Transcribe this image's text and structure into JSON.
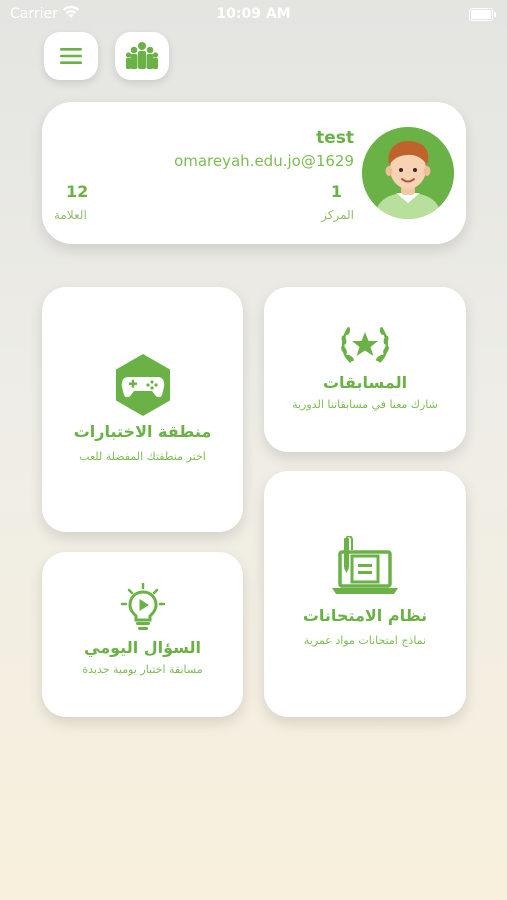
{
  "status_bar": {
    "carrier": "Carrier",
    "time": "10:09 AM"
  },
  "header": {
    "menu_icon": "hamburger-menu-icon",
    "group_icon": "people-group-icon"
  },
  "profile": {
    "name": "test",
    "email": "omareyah.edu.jo@1629",
    "rank_value": "1",
    "rank_label": "المركز",
    "score_value": "12",
    "score_label": "العلامة"
  },
  "tiles": {
    "competitions": {
      "title": "المسابقات",
      "subtitle": "شارك معنا في مسابقاتنا الدورية",
      "icon": "laurel-star-icon"
    },
    "tests_zone": {
      "title": "منطقة الاختبارات",
      "subtitle": "اختر منطقتك المفضلة للعب",
      "icon": "gamepad-icon"
    },
    "exams_system": {
      "title": "نظام الامتحانات",
      "subtitle": "نماذج امتحانات مواد عمرية",
      "icon": "laptop-document-icon"
    },
    "daily_question": {
      "title": "السؤال اليومي",
      "subtitle": "مسابقة اختبار يومية جديدة",
      "icon": "lightbulb-play-icon"
    }
  },
  "colors": {
    "accent": "#6ab246",
    "background_top": "#e4e4e1",
    "background_bottom": "#f8f0dc"
  }
}
